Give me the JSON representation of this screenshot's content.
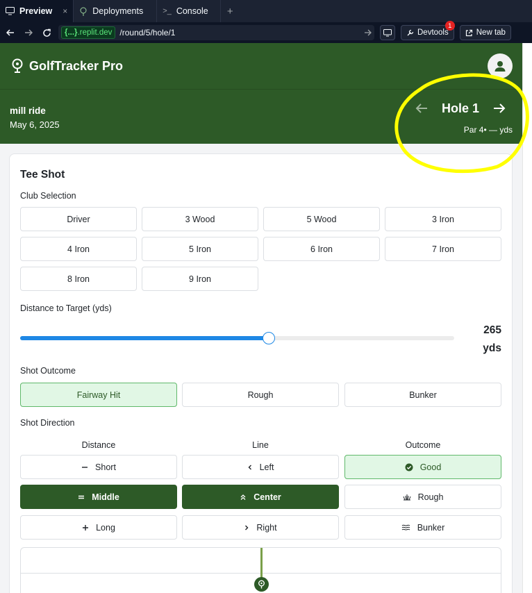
{
  "browser": {
    "tabs": [
      {
        "label": "Preview",
        "close": "×"
      },
      {
        "label": "Deployments"
      },
      {
        "label": "Console"
      }
    ],
    "new_tab": "+",
    "url_domain_prefix": "{...}",
    "url_domain_suffix": ".replit.dev",
    "url_path": "/round/5/hole/1",
    "devtools_label": "Devtools",
    "devtools_badge": "1",
    "newtab_label": "New tab"
  },
  "app": {
    "title": "GolfTracker Pro"
  },
  "round": {
    "name": "mill ride",
    "date": "May 6, 2025",
    "hole_title": "Hole 1",
    "hole_info": "Par 4• — yds"
  },
  "tee_shot": {
    "title": "Tee Shot",
    "club_label": "Club Selection",
    "clubs": [
      "Driver",
      "3 Wood",
      "5 Wood",
      "3 Iron",
      "4 Iron",
      "5 Iron",
      "6 Iron",
      "7 Iron",
      "8 Iron",
      "9 Iron"
    ],
    "distance_label": "Distance to Target (yds)",
    "distance_value": "265",
    "distance_unit": "yds",
    "distance_fraction": 0.573,
    "outcome_label": "Shot Outcome",
    "outcomes": [
      "Fairway Hit",
      "Rough",
      "Bunker"
    ],
    "selected_outcome": "Fairway Hit",
    "direction_label": "Shot Direction",
    "direction_columns": [
      "Distance",
      "Line",
      "Outcome"
    ],
    "distance_options": [
      {
        "icon": "minus-icon",
        "label": "Short"
      },
      {
        "icon": "equals-icon",
        "label": "Middle"
      },
      {
        "icon": "plus-icon",
        "label": "Long"
      }
    ],
    "line_options": [
      {
        "icon": "chevron-left-icon",
        "label": "Left"
      },
      {
        "icon": "double-chevron-up-icon",
        "label": "Center"
      },
      {
        "icon": "chevron-right-icon",
        "label": "Right"
      }
    ],
    "result_options": [
      {
        "icon": "check-circle-icon",
        "label": "Good"
      },
      {
        "icon": "grass-icon",
        "label": "Rough"
      },
      {
        "icon": "waves-icon",
        "label": "Bunker"
      }
    ],
    "selected": {
      "distance": "Middle",
      "line": "Center",
      "result": "Good"
    }
  },
  "colors": {
    "brand_green": "#2d5a27",
    "selected_light_bg": "#e1f7e5",
    "slider_blue": "#1e88e5",
    "annotation_yellow": "#ffff00"
  }
}
